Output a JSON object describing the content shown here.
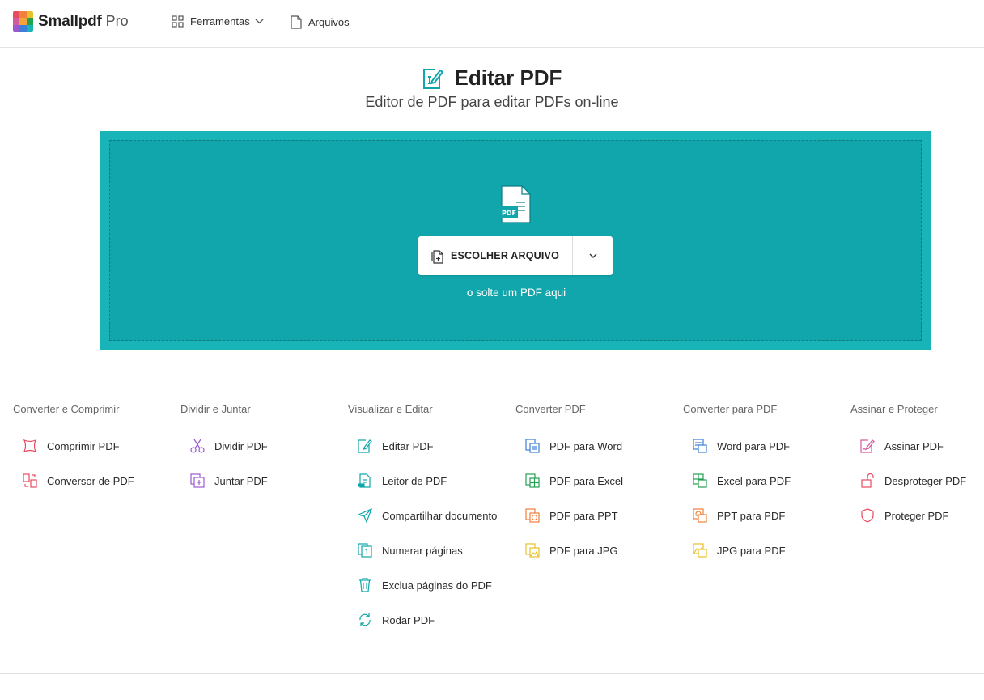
{
  "header": {
    "brand": "Smallpdf",
    "brand_suffix": "Pro",
    "nav_tools": "Ferramentas",
    "nav_files": "Arquivos"
  },
  "hero": {
    "title": "Editar PDF",
    "subtitle": "Editor de PDF para editar PDFs on-line"
  },
  "dropzone": {
    "file_badge": "PDF",
    "choose_label": "ESCOLHER ARQUIVO",
    "hint": "o solte um PDF aqui"
  },
  "colors": {
    "accent": "#18b4b8",
    "dropzone_inner": "#11a6ab",
    "compress": "#e84a5f",
    "split": "#9b59d0",
    "edit": "#11a6ab",
    "from_pdf_word": "#3d7fd8",
    "from_pdf_excel": "#23a052",
    "from_pdf_ppt": "#f0803c",
    "from_pdf_jpg": "#e8c02a",
    "sign": "#d45aa0"
  },
  "columns": [
    {
      "title": "Converter e Comprimir",
      "items": [
        {
          "label": "Comprimir PDF",
          "icon": "compress-icon"
        },
        {
          "label": "Conversor de PDF",
          "icon": "convert-icon"
        }
      ]
    },
    {
      "title": "Dividir e Juntar",
      "items": [
        {
          "label": "Dividir PDF",
          "icon": "scissors-icon"
        },
        {
          "label": "Juntar PDF",
          "icon": "merge-icon"
        }
      ]
    },
    {
      "title": "Visualizar e Editar",
      "items": [
        {
          "label": "Editar PDF",
          "icon": "edit-icon"
        },
        {
          "label": "Leitor de PDF",
          "icon": "reader-icon"
        },
        {
          "label": "Compartilhar documento",
          "icon": "share-icon"
        },
        {
          "label": "Numerar páginas",
          "icon": "numbering-icon"
        },
        {
          "label": "Exclua páginas do PDF",
          "icon": "trash-icon"
        },
        {
          "label": "Rodar PDF",
          "icon": "rotate-icon"
        }
      ]
    },
    {
      "title": "Converter PDF",
      "items": [
        {
          "label": "PDF para Word",
          "icon": "pdf-to-word-icon"
        },
        {
          "label": "PDF para Excel",
          "icon": "pdf-to-excel-icon"
        },
        {
          "label": "PDF para PPT",
          "icon": "pdf-to-ppt-icon"
        },
        {
          "label": "PDF para JPG",
          "icon": "pdf-to-jpg-icon"
        }
      ]
    },
    {
      "title": "Converter para PDF",
      "items": [
        {
          "label": "Word para PDF",
          "icon": "word-to-pdf-icon"
        },
        {
          "label": "Excel para PDF",
          "icon": "excel-to-pdf-icon"
        },
        {
          "label": "PPT para PDF",
          "icon": "ppt-to-pdf-icon"
        },
        {
          "label": "JPG para PDF",
          "icon": "jpg-to-pdf-icon"
        }
      ]
    },
    {
      "title": "Assinar e Proteger",
      "items": [
        {
          "label": "Assinar PDF",
          "icon": "sign-icon"
        },
        {
          "label": "Desproteger PDF",
          "icon": "unlock-icon"
        },
        {
          "label": "Proteger PDF",
          "icon": "shield-icon"
        }
      ]
    }
  ]
}
